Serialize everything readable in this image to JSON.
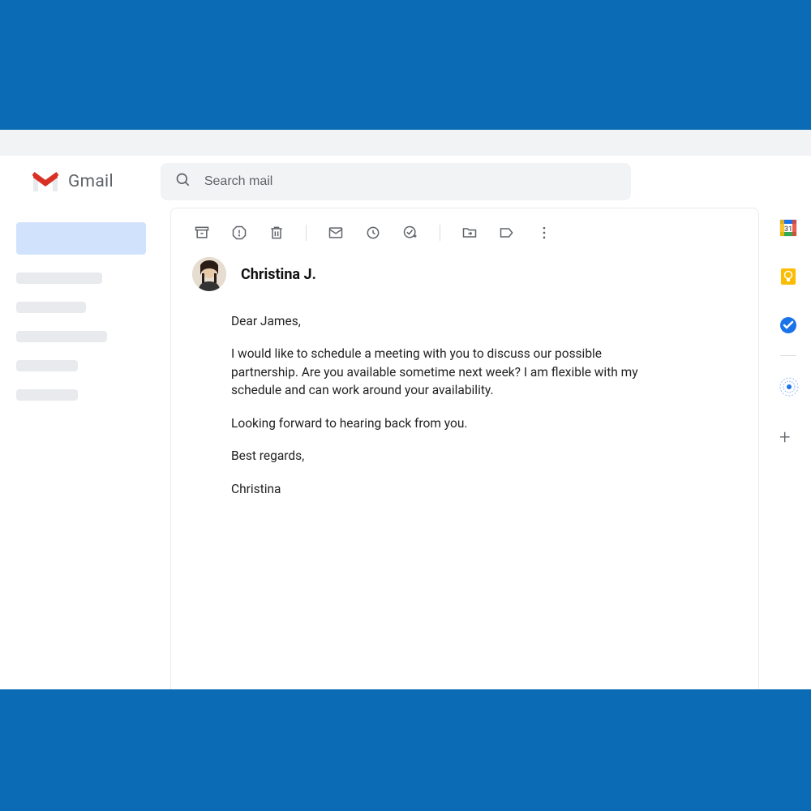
{
  "header": {
    "app_name": "Gmail",
    "search_placeholder": "Search mail"
  },
  "email": {
    "sender_name": "Christina J.",
    "greeting": "Dear James,",
    "paragraph1": "I would like to schedule a meeting with you to discuss our possible partnership. Are you available sometime next week? I am flexible with my schedule and can work around your availability.",
    "paragraph2": "Looking forward to hearing back from you.",
    "closing": "Best regards,",
    "signature": "Christina"
  },
  "toolbar_icons": {
    "archive": "archive-icon",
    "spam": "report-spam-icon",
    "delete": "delete-icon",
    "unread": "mark-unread-icon",
    "snooze": "snooze-icon",
    "add_task": "add-task-icon",
    "move": "move-to-icon",
    "labels": "labels-icon",
    "more": "more-icon"
  },
  "sideapps": {
    "calendar": "calendar-icon",
    "keep": "keep-icon",
    "tasks": "tasks-icon",
    "contacts": "contacts-icon",
    "add": "add-icon"
  },
  "colors": {
    "brand_red": "#d93025",
    "brand_blue": "#1a73e8",
    "brand_yellow": "#fbbc04",
    "bg_blue": "#0b6bb5"
  }
}
